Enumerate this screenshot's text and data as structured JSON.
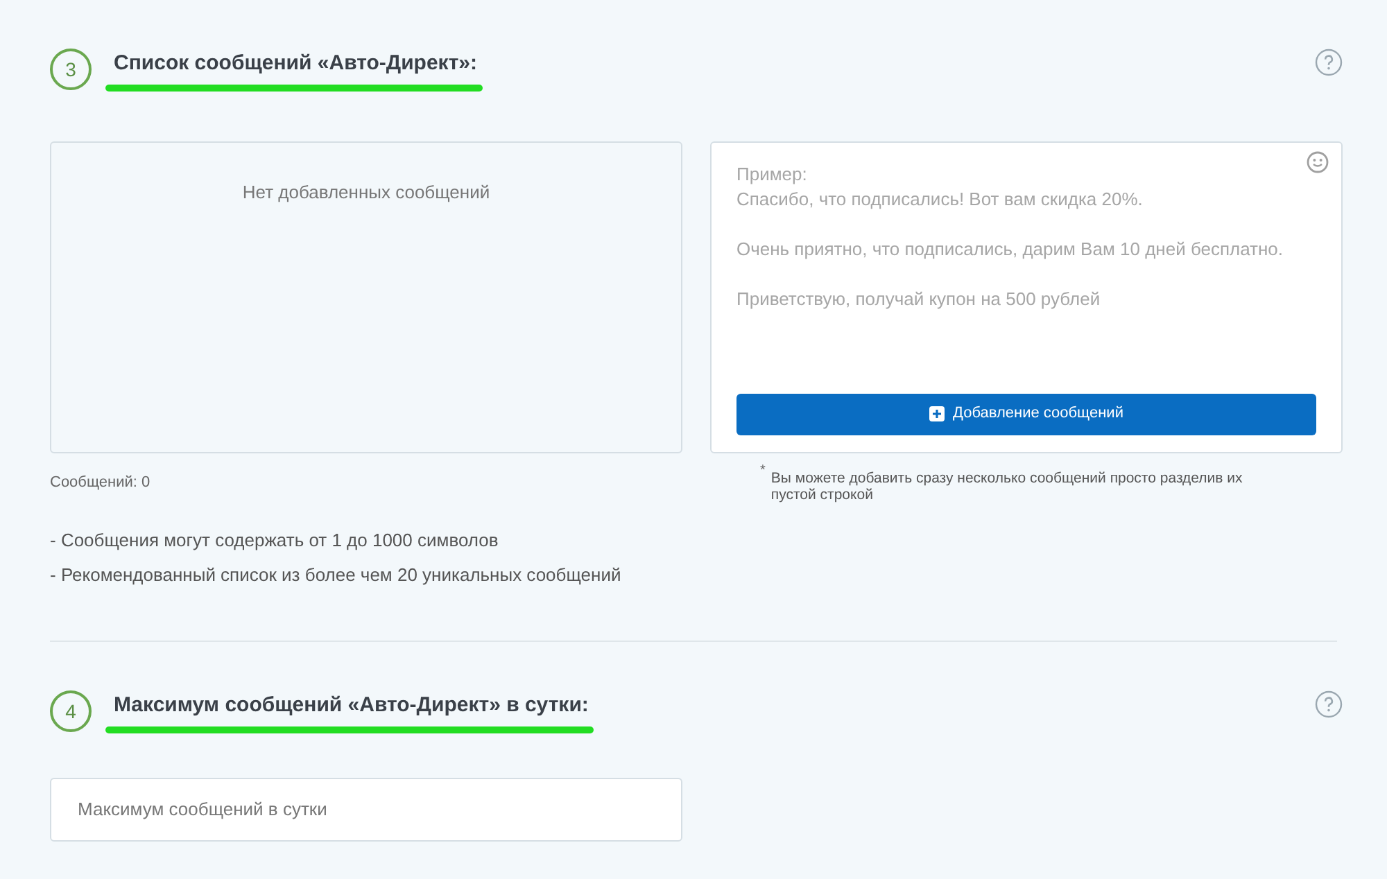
{
  "sections": [
    {
      "number": "3",
      "title": "Список сообщений «Авто-Директ»:",
      "kind": "messages",
      "list_box": {
        "empty_text": "Нет добавленных сообщений"
      },
      "counter": "Сообщений: 0",
      "notes": [
        "- Сообщения могут содержать от 1 до 1000 символов",
        "- Рекомендованный список из более чем 20 уникальных сообщений"
      ],
      "editor": {
        "placeholder": "Пример:\nСпасибо, что подписались! Вот вам скидка 20%.\n\nОчень приятно, что подписались, дарим Вам 10 дней бесплатно.\n\nПриветствую, получай купон на 500 рублей"
      },
      "add_button": "Добавление сообщений",
      "hint_mark": "*",
      "hint": "Вы можете добавить сразу несколько сообщений просто разделив их пустой строкой"
    },
    {
      "number": "4",
      "title": "Максимум сообщений «Авто-Директ» в сутки:",
      "kind": "limit",
      "field": {
        "placeholder": "Максимум сообщений в сутки"
      }
    }
  ]
}
